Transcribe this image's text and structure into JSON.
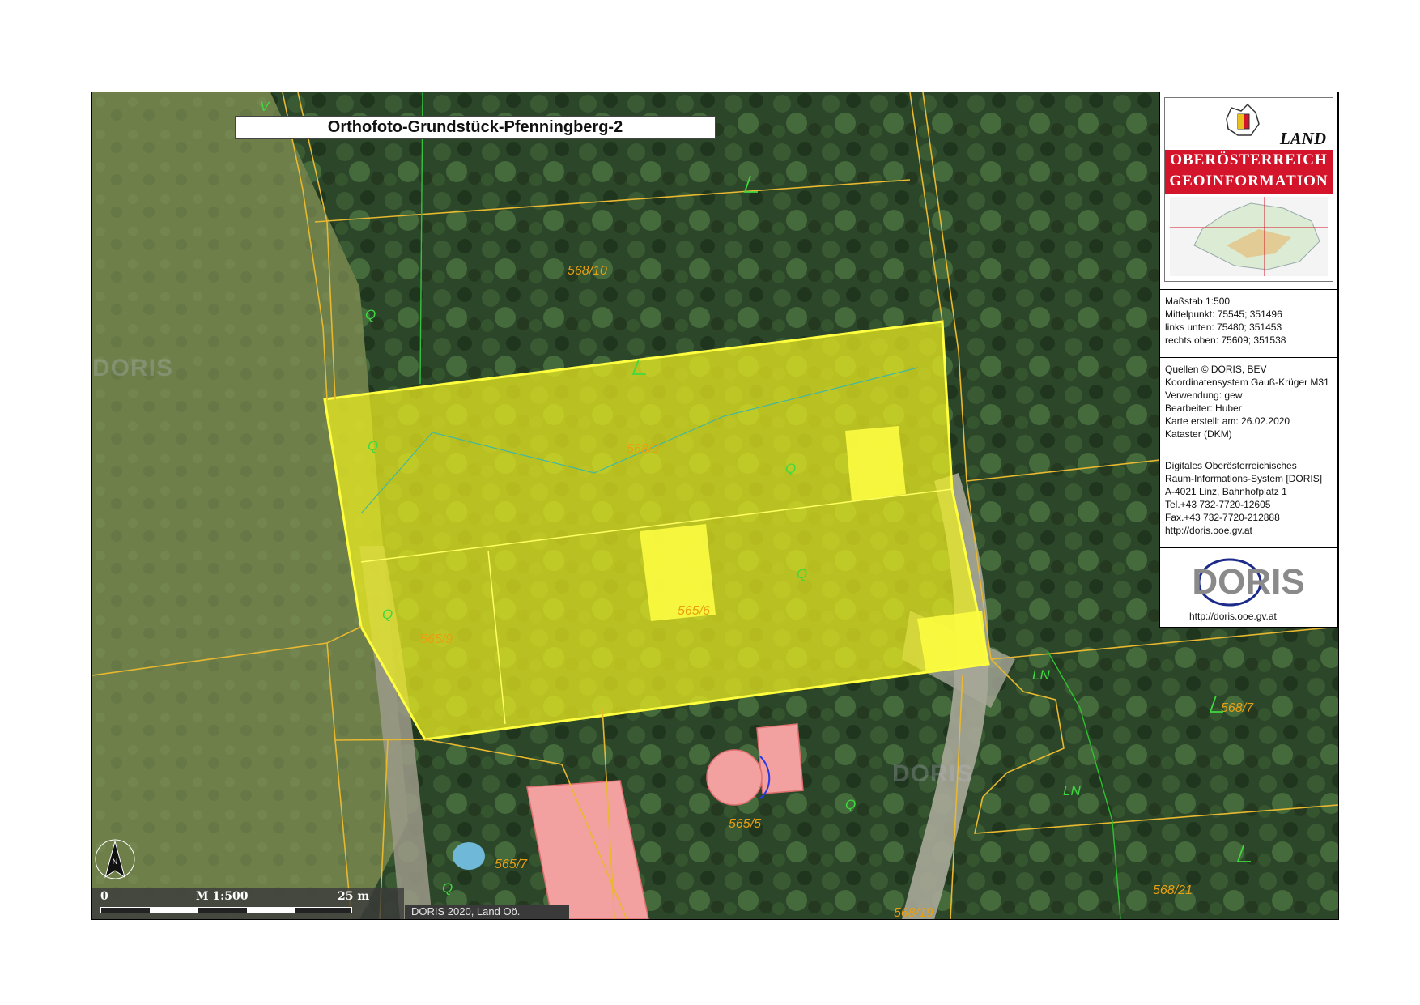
{
  "map": {
    "title": "Orthofoto-Grundstück-Pfenningberg-2",
    "plot_labels": [
      "568/10",
      "568/9",
      "565/6",
      "565/9",
      "568/7",
      "565/5",
      "565/7",
      "568/21",
      "568/19"
    ],
    "use_codes": [
      "V",
      "Q",
      "Q",
      "Q",
      "Q",
      "Q",
      "Q",
      "Q",
      "LN",
      "LN"
    ],
    "watermark": "DORIS",
    "highlight_color": "#f0f020",
    "boundary_color": "#e8b830",
    "building_color": "#f2a0a0",
    "scalebar": {
      "zero": "0",
      "label": "M 1:500",
      "end": "25 m"
    },
    "credit": "DORIS 2020, Land Oö.",
    "north_label": "N"
  },
  "legend": {
    "logo_land": "LAND",
    "logo_line1": "OBERÖSTERREICH",
    "logo_line2": "GEOINFORMATION",
    "scale": "Maßstab 1:500",
    "center": "Mittelpunkt: 75545; 351496",
    "bottom_left": "links unten: 75480; 351453",
    "top_right": "rechts oben: 75609; 351538",
    "sources": "Quellen © DORIS, BEV",
    "crs": "Koordinatensystem Gauß-Krüger M31",
    "usage": "Verwendung: gew",
    "editor": "Bearbeiter: Huber",
    "created": "Karte erstellt am: 26.02.2020",
    "cadastre": "Kataster (DKM)",
    "org_name1": "Digitales Oberösterreichisches",
    "org_name2": "Raum-Informations-System [DORIS]",
    "address": "A-4021 Linz, Bahnhofplatz 1",
    "tel": "Tel.+43 732-7720-12605",
    "fax": "Fax.+43 732-7720-212888",
    "url": "http://doris.ooe.gv.at",
    "doris_logo_text": "DORIS",
    "doris_logo_url": "http://doris.ooe.gv.at"
  }
}
